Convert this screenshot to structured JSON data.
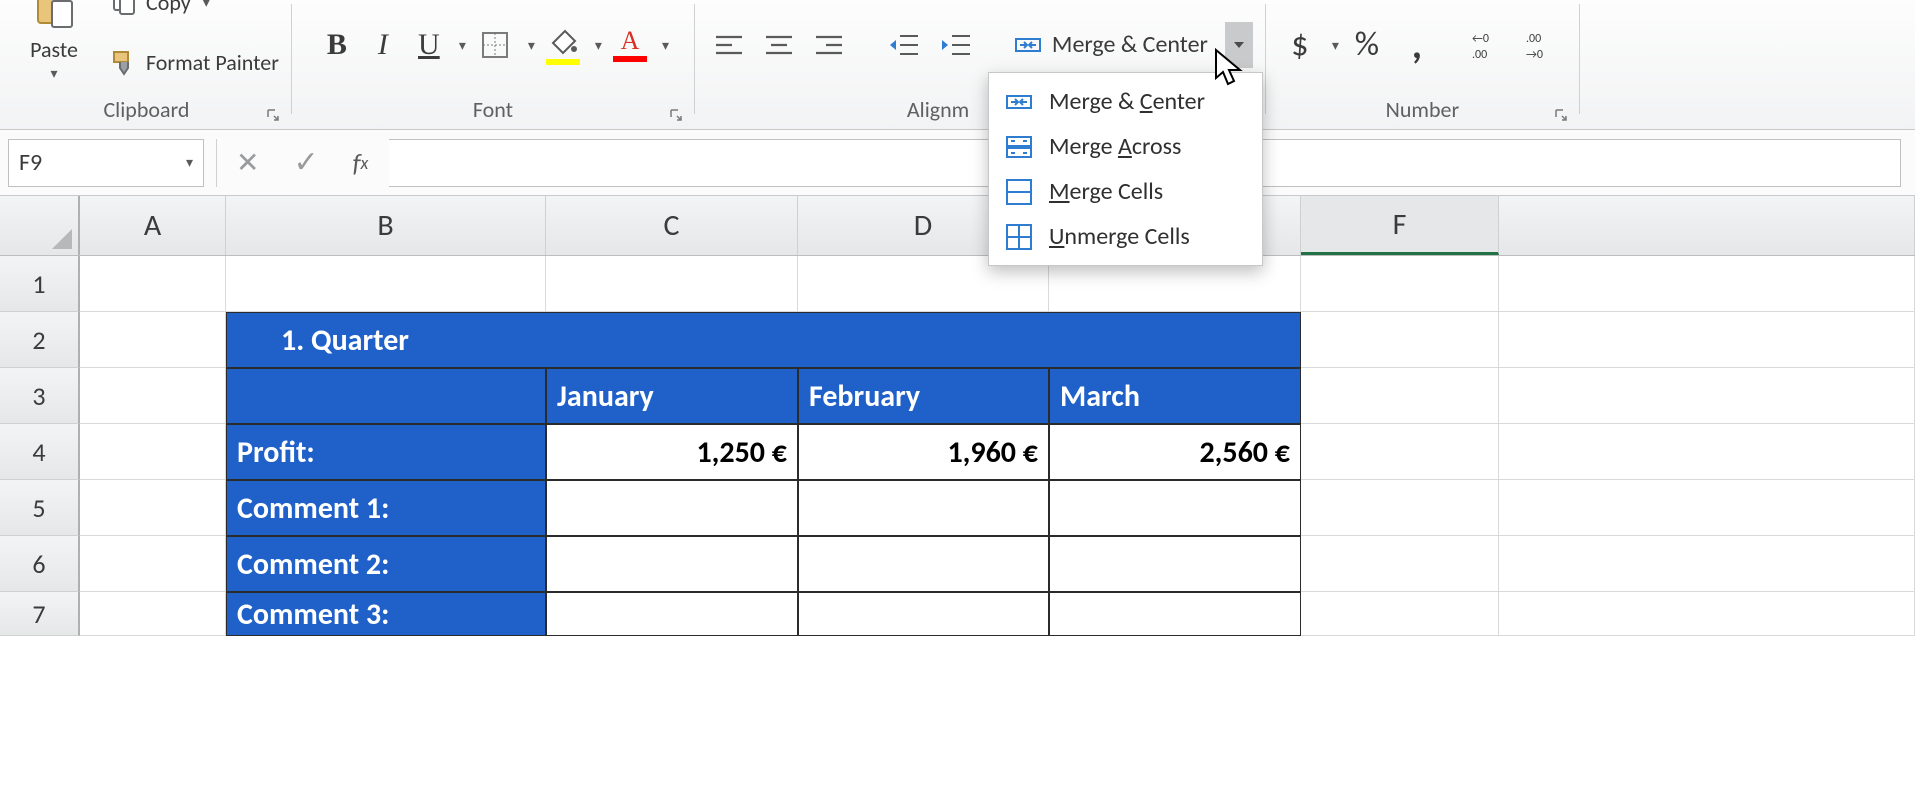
{
  "ribbon": {
    "clipboard": {
      "paste_label": "Paste",
      "copy_label": "Copy",
      "format_painter_label": "Format Painter",
      "group_label": "Clipboard"
    },
    "font": {
      "bold": "B",
      "italic": "I",
      "underline": "U",
      "group_label": "Font"
    },
    "alignment": {
      "merge_label": "Merge & Center",
      "group_label": "Alignm",
      "dropdown": {
        "merge_center": "Merge & Center",
        "merge_across": "Merge Across",
        "merge_cells": "Merge Cells",
        "unmerge_cells": "Unmerge Cells"
      }
    },
    "number": {
      "currency": "$",
      "percent": "%",
      "comma": ",",
      "group_label": "Number"
    }
  },
  "namebox": "F9",
  "columns": [
    "A",
    "B",
    "C",
    "D",
    "",
    "F",
    ""
  ],
  "row_numbers": [
    "1",
    "2",
    "3",
    "4",
    "5",
    "6",
    "7"
  ],
  "table": {
    "title": "1. Quarter",
    "months": [
      "January",
      "February",
      "March"
    ],
    "profit_label": "Profit:",
    "profit": [
      "1,250 €",
      "1,960 €",
      "2,560 €"
    ],
    "comments": [
      "Comment 1:",
      "Comment 2:",
      "Comment 3:"
    ]
  },
  "chart_data": {
    "type": "table",
    "title": "1. Quarter",
    "categories": [
      "January",
      "February",
      "March"
    ],
    "series": [
      {
        "name": "Profit (€)",
        "values": [
          1250,
          1960,
          2560
        ]
      }
    ]
  }
}
